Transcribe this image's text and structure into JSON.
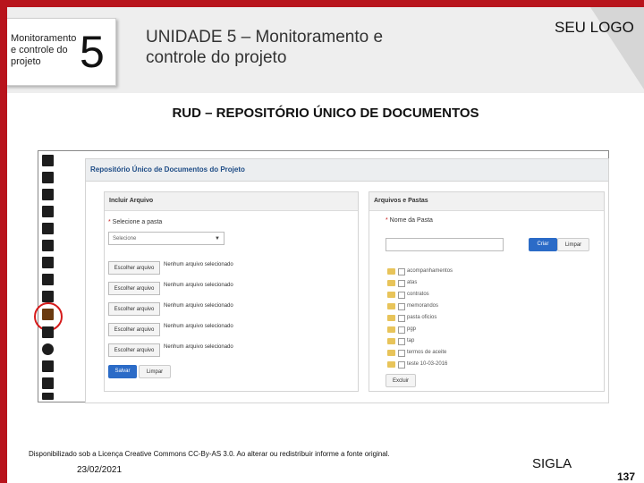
{
  "slide": {
    "module_label": "Monitoramento e controle do projeto",
    "module_number": "5",
    "unit_title": "UNIDADE 5 – Monitoramento e controle do projeto",
    "logo": "SEU LOGO",
    "rud_title": "RUD – REPOSITÓRIO ÚNICO DE DOCUMENTOS",
    "footer": "Disponibilizado sob a Licença Creative Commons CC-By-AS 3.0. Ao alterar ou redistribuir informe a fonte original.",
    "date": "23/02/2021",
    "sigla": "SIGLA",
    "page_number": "137"
  },
  "icons": [
    "calendar-icon",
    "pulse-icon",
    "user-icon",
    "microphone-icon",
    "fire-icon",
    "document-icon",
    "chart-icon",
    "table-icon",
    "refresh-icon",
    "repository-icon",
    "copy-icon",
    "check-icon",
    "list-icon",
    "archive-icon",
    "settings-icon"
  ],
  "selected_icon": "repository-icon",
  "app": {
    "header": "Repositório Único de Documentos do Projeto",
    "left_panel": {
      "title": "Incluir Arquivo",
      "folder_label": "Selecione a pasta",
      "folder_select": "Selecione",
      "file_button": "Escolher arquivo",
      "file_status": "Nenhum arquivo selecionado",
      "file_rows": 5,
      "save_button": "Salvar",
      "clear_button": "Limpar"
    },
    "right_panel": {
      "title": "Arquivos e Pastas",
      "name_label": "Nome da Pasta",
      "create_button": "Criar",
      "clear_button": "Limpar",
      "folders": [
        "acompanhamentos",
        "atas",
        "contratos",
        "memorandos",
        "pasta oficios",
        "pgp",
        "tap",
        "termos de aceite",
        "teste 10-03-2016"
      ],
      "delete_button": "Excluir"
    }
  },
  "colors": {
    "accent": "#b8141c",
    "link_blue": "#1e4c86",
    "button_blue": "#2b6bc7",
    "highlight_ring": "#d61b1b"
  }
}
